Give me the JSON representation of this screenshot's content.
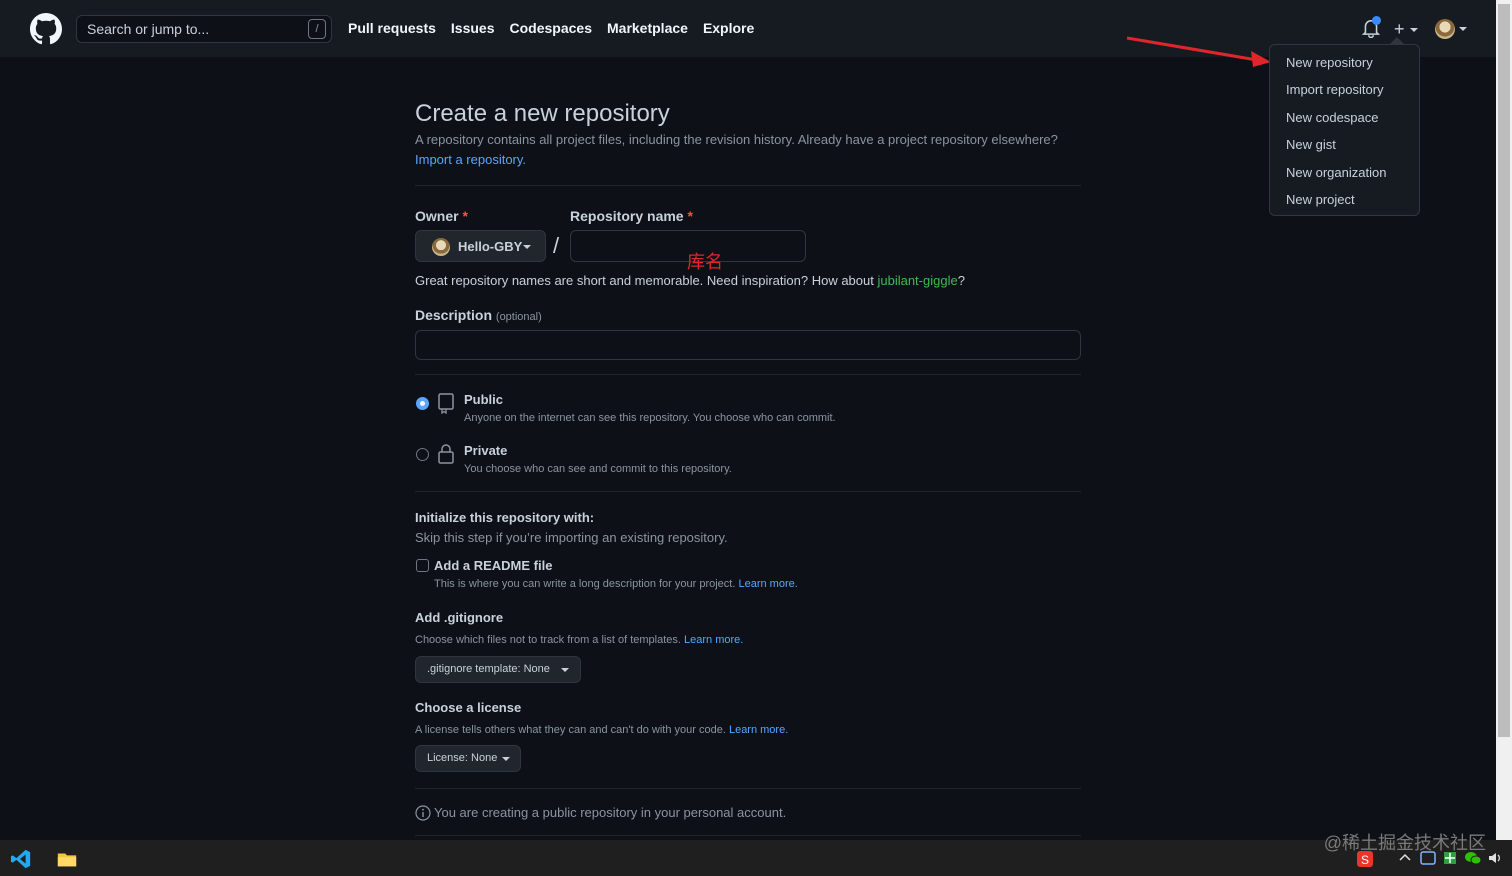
{
  "header": {
    "search_placeholder": "Search or jump to...",
    "search_key": "/",
    "nav": [
      "Pull requests",
      "Issues",
      "Codespaces",
      "Marketplace",
      "Explore"
    ],
    "plus": "+"
  },
  "dropdown": {
    "items": [
      "New repository",
      "Import repository",
      "New codespace",
      "New gist",
      "New organization",
      "New project"
    ]
  },
  "page": {
    "title": "Create a new repository",
    "subtitle": "A repository contains all project files, including the revision history. Already have a project repository elsewhere?",
    "import_link": "Import a repository.",
    "owner_label": "Owner",
    "required_mark": "*",
    "repo_name_label": "Repository name",
    "owner_value": "Hello-GBY",
    "slash": "/",
    "annotation": "库名",
    "hint_prefix": "Great repository names are short and memorable. Need inspiration? How about ",
    "hint_suggestion": "jubilant-giggle",
    "hint_suffix": "?",
    "description_label": "Description",
    "description_optional": "(optional)",
    "public_label": "Public",
    "public_desc": "Anyone on the internet can see this repository. You choose who can commit.",
    "private_label": "Private",
    "private_desc": "You choose who can see and commit to this repository.",
    "init_title": "Initialize this repository with:",
    "init_desc": "Skip this step if you’re importing an existing repository.",
    "readme_label": "Add a README file",
    "readme_desc": "This is where you can write a long description for your project.",
    "learn_more": "Learn more.",
    "gitignore_title": "Add .gitignore",
    "gitignore_desc": "Choose which files not to track from a list of templates.",
    "gitignore_btn": ".gitignore template: None",
    "license_title": "Choose a license",
    "license_desc": "A license tells others what they can and can't do with your code.",
    "license_btn": "License: None",
    "notice": "You are creating a public repository in your personal account."
  },
  "watermark": "@稀土掘金技术社区",
  "colors": {
    "bg": "#0d1117",
    "header": "#161b22",
    "link": "#58a6ff",
    "green": "#3fb950",
    "required": "#f85149",
    "arrow": "#e0262b"
  }
}
